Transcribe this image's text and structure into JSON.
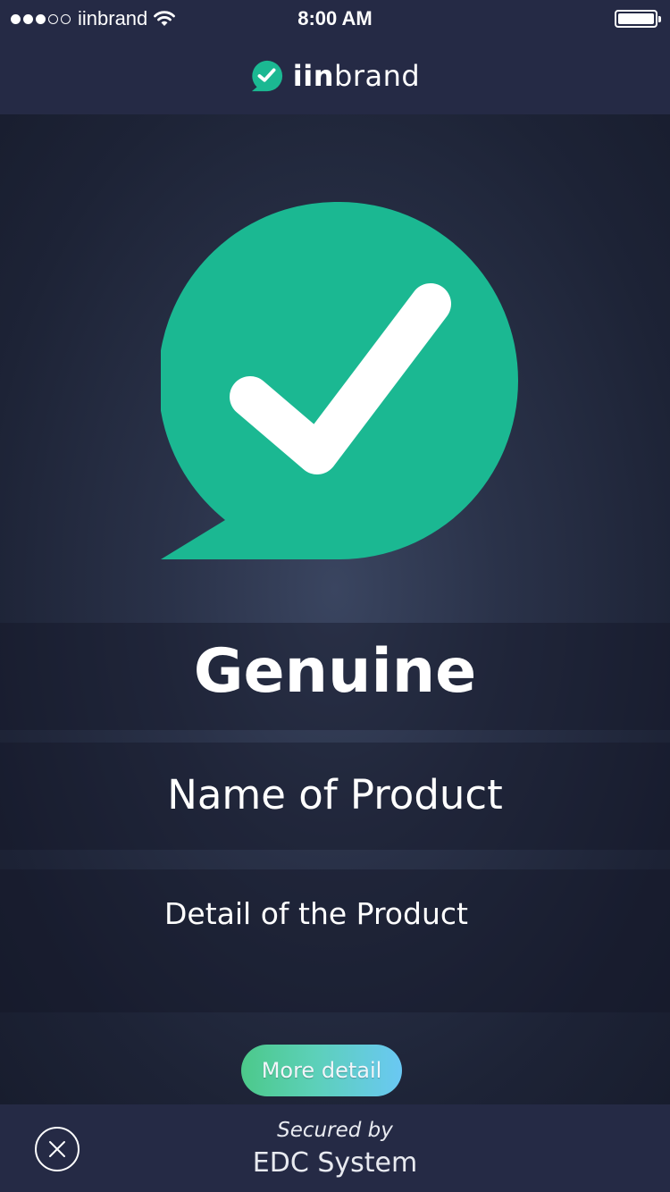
{
  "status_bar": {
    "carrier": "iinbrand",
    "time": "8:00 AM",
    "signal_strength_dots": 3,
    "signal_total_dots": 5,
    "icons": [
      "signal-dots-icon",
      "wifi-icon",
      "battery-icon"
    ]
  },
  "header": {
    "brand_bold": "iin",
    "brand_rest": "brand",
    "logo_icon": "check-speech-bubble-icon"
  },
  "result": {
    "status": "Genuine",
    "product_name": "Name of Product",
    "product_detail": "Detail of the Product",
    "icon": "check-speech-bubble-icon",
    "more_button_label": "More detail"
  },
  "footer": {
    "secured_by": "Secured by",
    "system_name": "EDC System",
    "close_icon": "close-icon"
  },
  "colors": {
    "accent_green": "#1bb892",
    "bar_background": "#252a45",
    "main_background": "#1f2538",
    "button_gradient_start": "#4cc98a",
    "button_gradient_end": "#6ac8f3"
  }
}
